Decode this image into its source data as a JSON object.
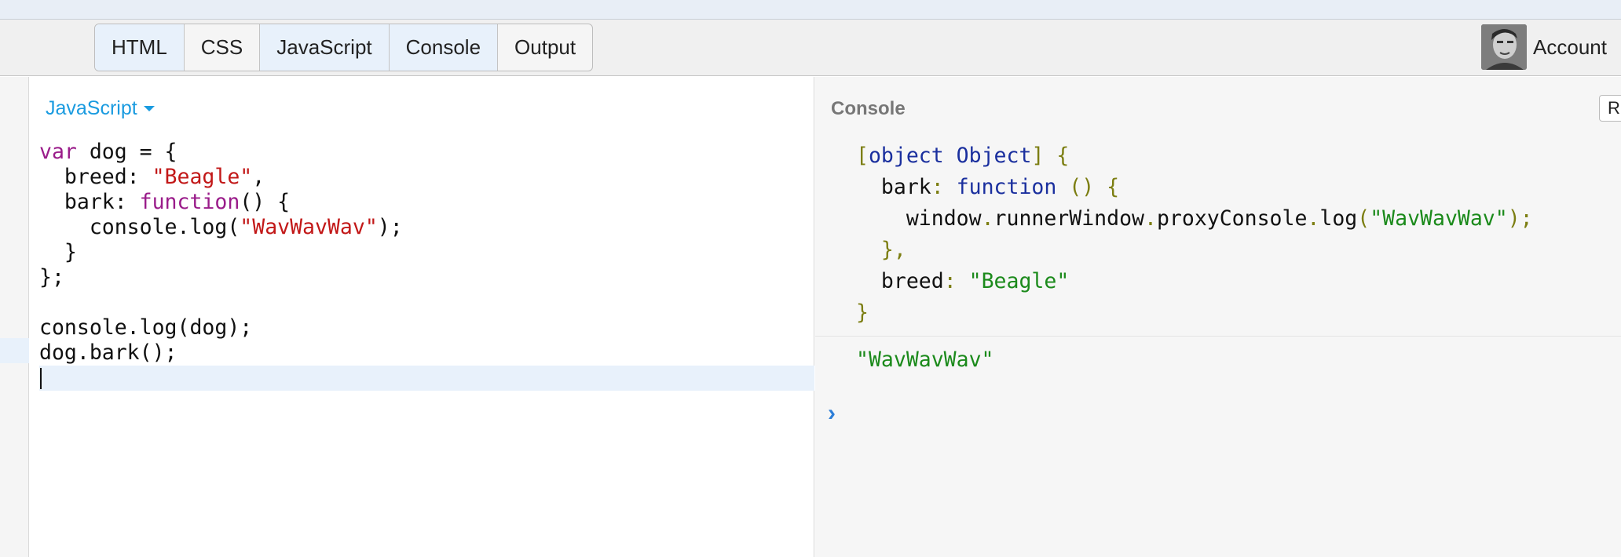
{
  "tabs": [
    {
      "label": "HTML",
      "active": true
    },
    {
      "label": "CSS",
      "active": false
    },
    {
      "label": "JavaScript",
      "active": true
    },
    {
      "label": "Console",
      "active": true
    },
    {
      "label": "Output",
      "active": false
    }
  ],
  "account": {
    "label": "Account"
  },
  "editor": {
    "language": "JavaScript",
    "code": {
      "l1": {
        "kw": "var",
        "rest": " dog = {"
      },
      "l2": {
        "pre": "  breed: ",
        "str": "\"Beagle\"",
        "post": ","
      },
      "l3": {
        "pre": "  bark: ",
        "kw": "function",
        "post": "() {"
      },
      "l4": {
        "pre": "    console.log(",
        "str": "\"WavWavWav\"",
        "post": ");"
      },
      "l5": "  }",
      "l6": "};",
      "l7": "",
      "l8": "console.log(dog);",
      "l9": "dog.bark();"
    }
  },
  "console": {
    "title": "Console",
    "run_label": "R",
    "object": {
      "open_bracket": "[",
      "type1": "object",
      "type2": "Object",
      "close_bracket": "]",
      "brace_open": "{",
      "bark_key": "bark",
      "colon": ":",
      "fn_kw": "function",
      "fn_parens": "() {",
      "body_a": "window",
      "dot": ".",
      "body_b": "runnerWindow",
      "body_c": "proxyConsole",
      "body_d": "log",
      "paren_open": "(",
      "body_str": "\"WavWavWav\"",
      "paren_close": ");",
      "fn_close": "},",
      "breed_key": "breed",
      "breed_val": "\"Beagle\"",
      "brace_close": "}"
    },
    "log2": "\"WavWavWav\"",
    "prompt": "›"
  }
}
